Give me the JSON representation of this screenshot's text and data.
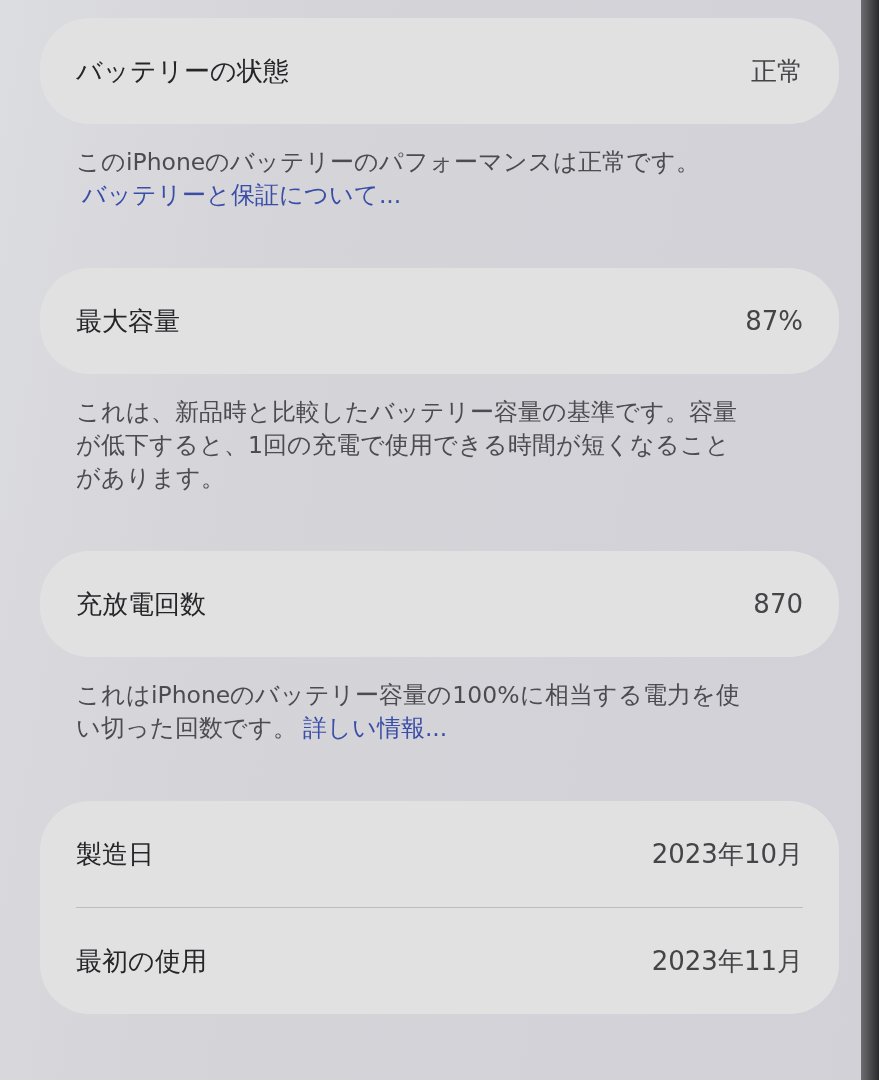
{
  "sections": [
    {
      "rows": [
        {
          "label": "バッテリーの状態",
          "value": "正常"
        }
      ],
      "footer": {
        "text": "このiPhoneのバッテリーのパフォーマンスは正常です。",
        "link": "バッテリーと保証について..."
      }
    },
    {
      "rows": [
        {
          "label": "最大容量",
          "value": "87%"
        }
      ],
      "footer": {
        "text": "これは、新品時と比較したバッテリー容量の基準です。容量が低下すると、1回の充電で使用できる時間が短くなることがあります。"
      }
    },
    {
      "rows": [
        {
          "label": "充放電回数",
          "value": "870"
        }
      ],
      "footer": {
        "text": "これはiPhoneのバッテリー容量の100%に相当する電力を使い切った回数です。",
        "link": "詳しい情報..."
      }
    },
    {
      "rows": [
        {
          "label": "製造日",
          "value": "2023年10月"
        },
        {
          "label": "最初の使用",
          "value": "2023年11月"
        }
      ]
    }
  ]
}
